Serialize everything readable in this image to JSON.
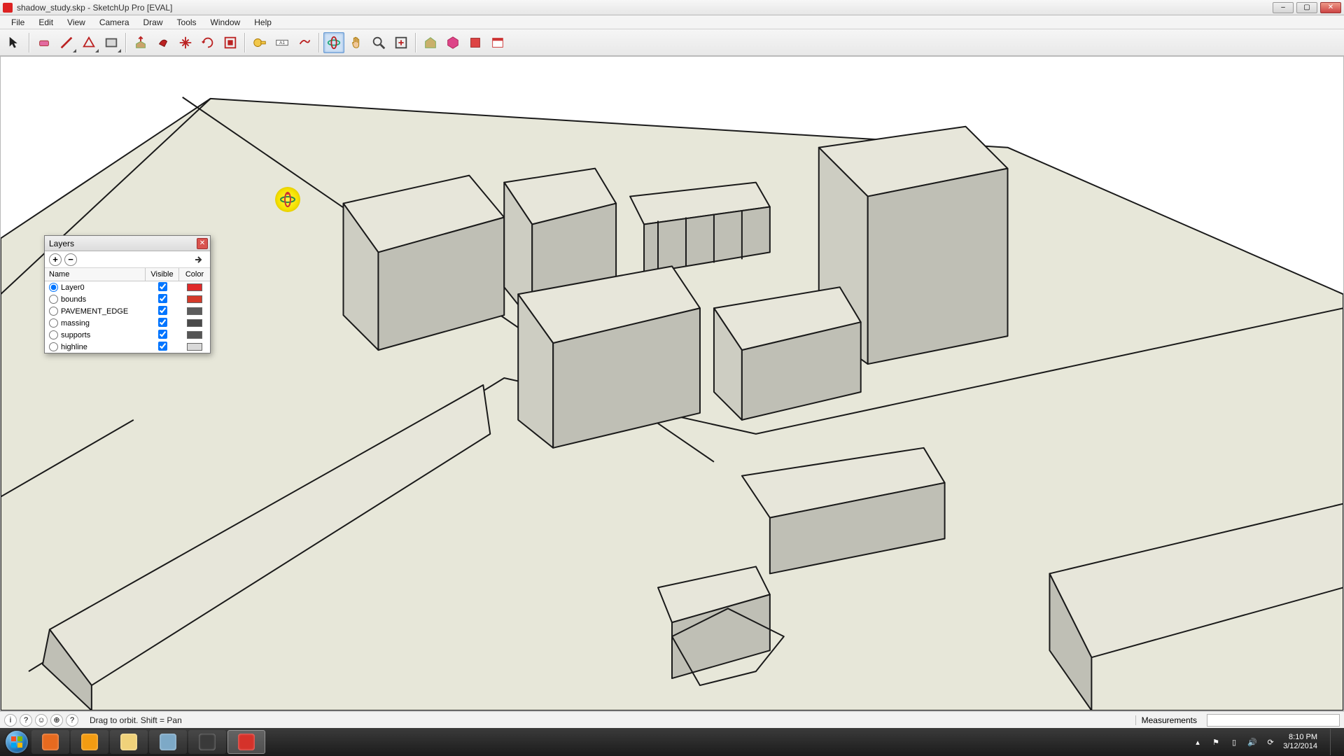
{
  "window": {
    "title": "shadow_study.skp - SketchUp Pro [EVAL]",
    "controls": {
      "min": "–",
      "max": "▢",
      "close": "✕"
    }
  },
  "menus": [
    "File",
    "Edit",
    "View",
    "Camera",
    "Draw",
    "Tools",
    "Window",
    "Help"
  ],
  "toolbar": {
    "tools": [
      {
        "name": "select-tool"
      },
      {
        "name": "eraser-tool"
      },
      {
        "name": "line-tool",
        "dropdown": true
      },
      {
        "name": "shape-tool",
        "dropdown": true
      },
      {
        "name": "rectangle-tool",
        "dropdown": true
      },
      {
        "name": "pushpull-tool"
      },
      {
        "name": "paint-tool"
      },
      {
        "name": "move-tool"
      },
      {
        "name": "rotate-tool"
      },
      {
        "name": "scale-tool"
      },
      {
        "name": "tape-tool"
      },
      {
        "name": "dimension-tool"
      },
      {
        "name": "text-tool"
      },
      {
        "name": "orbit-tool",
        "active": true
      },
      {
        "name": "pan-tool"
      },
      {
        "name": "zoom-tool"
      },
      {
        "name": "zoom-extents-tool"
      },
      {
        "name": "warehouse-tool"
      },
      {
        "name": "component-tool"
      },
      {
        "name": "extension-tool"
      },
      {
        "name": "layout-tool"
      }
    ]
  },
  "layers_panel": {
    "title": "Layers",
    "columns": {
      "name": "Name",
      "visible": "Visible",
      "color": "Color"
    },
    "rows": [
      {
        "name": "Layer0",
        "active": true,
        "visible": true,
        "color": "#e02a2a"
      },
      {
        "name": "bounds",
        "active": false,
        "visible": true,
        "color": "#d43a2a"
      },
      {
        "name": "PAVEMENT_EDGE",
        "active": false,
        "visible": true,
        "color": "#5c5c5c"
      },
      {
        "name": "massing",
        "active": false,
        "visible": true,
        "color": "#4a4a4a"
      },
      {
        "name": "supports",
        "active": false,
        "visible": true,
        "color": "#555555"
      },
      {
        "name": "highline",
        "active": false,
        "visible": true,
        "color": "#d9d9d9"
      }
    ]
  },
  "statusbar": {
    "hint": "Drag to orbit.  Shift = Pan",
    "measurements_label": "Measurements"
  },
  "taskbar": {
    "items": [
      {
        "name": "firefox",
        "color": "#e66a1f"
      },
      {
        "name": "illustrator",
        "color": "#f39c12"
      },
      {
        "name": "explorer",
        "color": "#f0d27a"
      },
      {
        "name": "file",
        "color": "#7da9c7"
      },
      {
        "name": "app",
        "color": "#3a3a3a"
      },
      {
        "name": "sketchup",
        "color": "#d5322a",
        "active": true
      }
    ],
    "clock": {
      "time": "8:10 PM",
      "date": "3/12/2014"
    }
  }
}
